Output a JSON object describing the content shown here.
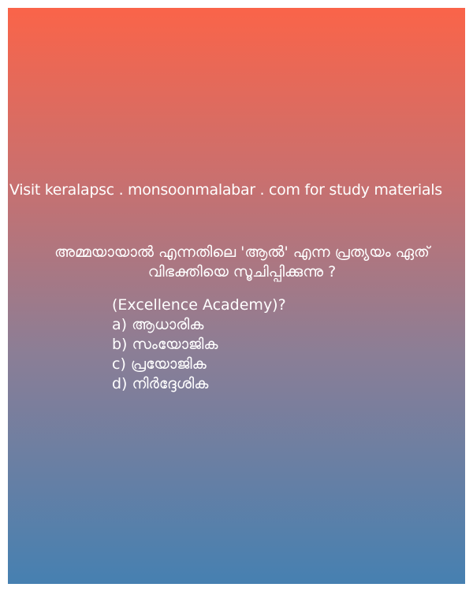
{
  "promo": {
    "site_text": "Visit keralapsc . monsoonmalabar . com for study materials"
  },
  "question": {
    "text": "അമ്മയായാൽ എന്നതിലെ 'ആൽ' എന്ന  പ്രത്യയം ഏത് വിഭക്തിയെ സൂചിപ്പിക്കുന്നു ?",
    "source": "(Excellence Academy)?"
  },
  "options": [
    {
      "text": "a) ആധാരിക"
    },
    {
      "text": "b) സംയോജിക"
    },
    {
      "text": "c) പ്രയോജിക"
    },
    {
      "text": "d) നിർദ്ദേശിക"
    }
  ]
}
